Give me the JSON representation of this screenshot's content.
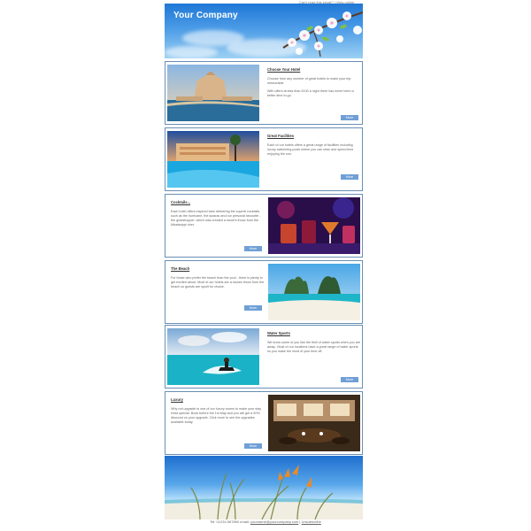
{
  "preheader": {
    "cant_read": "Can't read this email?",
    "view_online": "View online"
  },
  "header": {
    "company_name": "Your Company"
  },
  "cards": [
    {
      "title": "Choose Your Hotel",
      "paragraphs": [
        "Choose from any number of great hotels to make your trip memorable.",
        "With offers at less than £100 a night there has never been a better time to go."
      ],
      "button": "More"
    },
    {
      "title": "Great Facilities",
      "paragraphs": [
        "Each of our hotels offers a great range of facilities including luxury swimming pools where you can relax and spend time enjoying the sun."
      ],
      "button": "More"
    },
    {
      "title": "Cocktails...",
      "paragraphs": [
        "Each hotel offers inspired bars delivering the superb cocktails such as the hurricane, the lazarac and our personal favourite - the grasshopper, which was created a stone's throw from the Mississippi river."
      ],
      "button": "More"
    },
    {
      "title": "The Beach",
      "paragraphs": [
        "For those who prefer the beach than the pool - there is plenty to get excited about. Most of our hotels are a stones throw from the beach so guests are spoilt for choice."
      ],
      "button": "More"
    },
    {
      "title": "Water Sports",
      "paragraphs": [
        "We know some of you like the thrill of water sports when you are away.. Most of our locations have a great range of water sports so you make the most of your time off."
      ],
      "button": "More"
    },
    {
      "title": "Luxury",
      "paragraphs": [
        "Why not upgrade to one of our luxury rooms to make your stay extra special. Book before the 1st May and you will get a 50% discount on your upgrade. Click more to see the upgrades available today."
      ],
      "button": "More"
    }
  ],
  "footer": {
    "tel": "Tel: 01234 567890",
    "email_label": "email:",
    "email": "yourname@yourcompany.com",
    "unsubscribe": "Unsubscribe"
  },
  "colors": {
    "card_border": "#6a8fb5",
    "button": "#6f9fd6",
    "header_sky": "#1f78d6"
  }
}
